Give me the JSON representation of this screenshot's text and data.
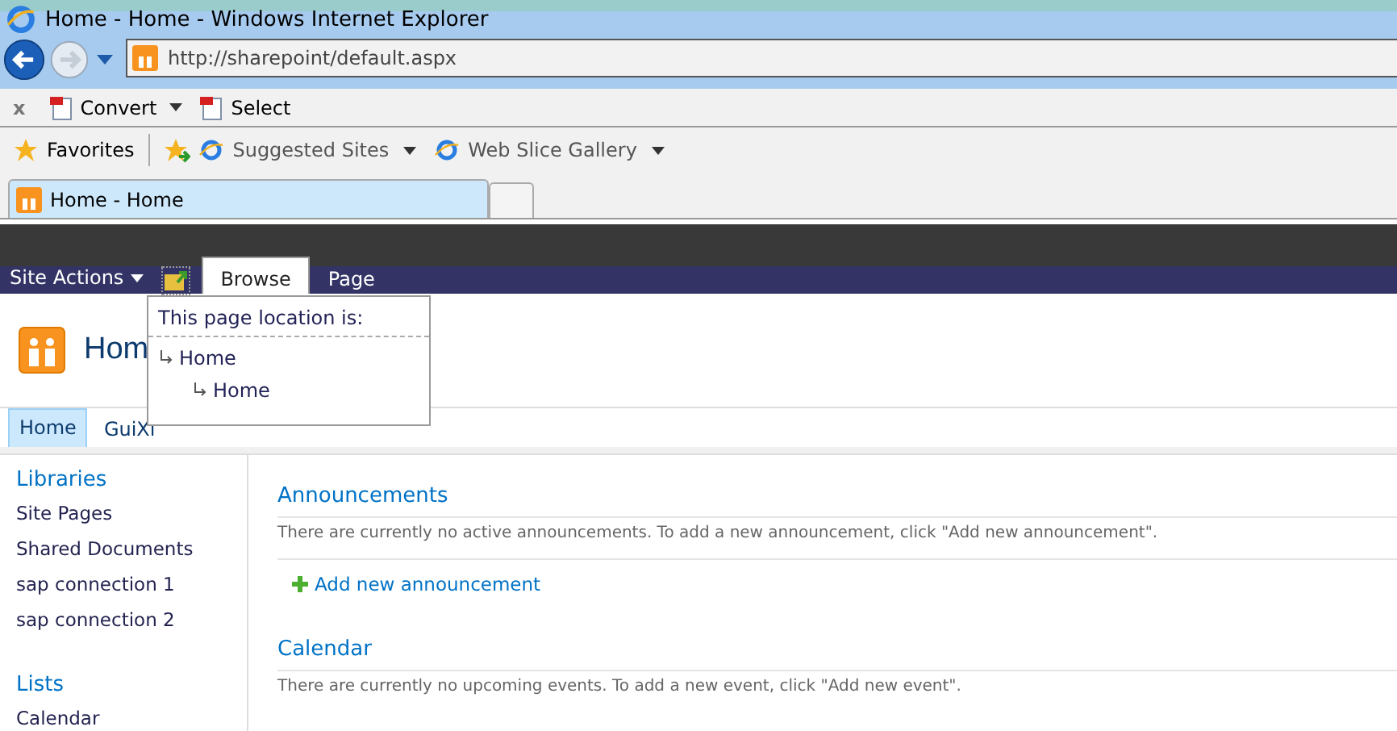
{
  "window": {
    "title": "Home - Home - Windows Internet Explorer"
  },
  "address_bar": {
    "value": "http://sharepoint/default.aspx"
  },
  "command_bar": {
    "close": "x",
    "items": [
      {
        "label": "Convert",
        "dropdown": true
      },
      {
        "label": "Select",
        "dropdown": false
      }
    ]
  },
  "favorites_bar": {
    "favorites": "Favorites",
    "items": [
      {
        "label": "Suggested Sites"
      },
      {
        "label": "Web Slice Gallery"
      }
    ]
  },
  "tabs": [
    {
      "label": "Home - Home",
      "selected": true
    },
    {
      "selected": false
    }
  ],
  "ribbon": {
    "site_actions": "Site Actions",
    "tabs": [
      {
        "label": "Browse",
        "selected": true
      },
      {
        "label": "Page",
        "selected": false
      }
    ]
  },
  "location_popup": {
    "heading": "This page location is:",
    "path": [
      {
        "label": "Home",
        "children": [
          {
            "label": "Home"
          }
        ]
      }
    ]
  },
  "site": {
    "title": "Hom"
  },
  "top_nav": [
    {
      "label": "Home",
      "selected": true
    },
    {
      "label": "GuiXi",
      "selected": false
    }
  ],
  "quick_launch": [
    {
      "heading": "Libraries",
      "items": [
        "Site Pages",
        "Shared Documents",
        "sap connection 1",
        "sap connection 2"
      ]
    },
    {
      "heading": "Lists",
      "items": [
        "Calendar"
      ]
    }
  ],
  "web_parts": [
    {
      "title": "Announcements",
      "message": "There are currently no active announcements. To add a new announcement, click \"Add new announcement\".",
      "add_link": "Add new announcement"
    },
    {
      "title": "Calendar",
      "message": "There are currently no upcoming events. To add a new event, click \"Add new event\"."
    }
  ]
}
